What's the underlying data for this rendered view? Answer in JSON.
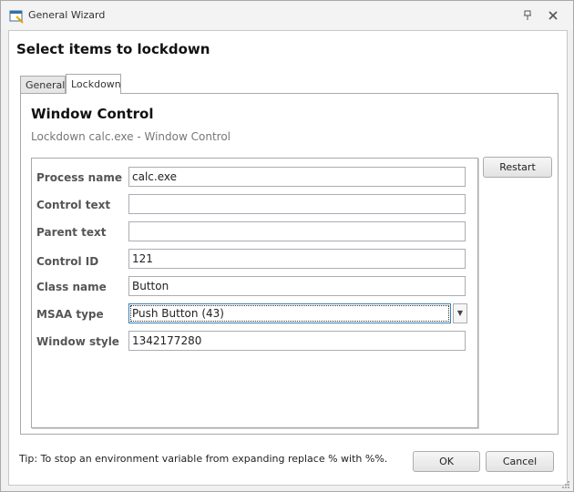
{
  "window": {
    "title": "General Wizard"
  },
  "page": {
    "title": "Select items to lockdown"
  },
  "tabs": [
    {
      "label": "General",
      "selected": false
    },
    {
      "label": "Lockdown",
      "selected": true
    }
  ],
  "section": {
    "title": "Window Control",
    "subtitle": "Lockdown calc.exe - Window Control"
  },
  "fields": {
    "process_name": {
      "label": "Process name",
      "value": "calc.exe"
    },
    "control_text": {
      "label": "Control text",
      "value": ""
    },
    "parent_text": {
      "label": "Parent text",
      "value": ""
    },
    "control_id": {
      "label": "Control ID",
      "value": "121"
    },
    "class_name": {
      "label": "Class name",
      "value": "Button"
    },
    "msaa_type": {
      "label": "MSAA type",
      "value": "Push Button (43)"
    },
    "window_style": {
      "label": "Window style",
      "value": "1342177280"
    }
  },
  "buttons": {
    "restart": "Restart",
    "ok": "OK",
    "cancel": "Cancel"
  },
  "tip": "Tip: To stop an environment variable from expanding replace % with %%.",
  "icons": {
    "app": "wizard-window-icon",
    "pin": "pin-icon",
    "close": "close-icon",
    "dropdown": "chevron-down-icon",
    "resize": "resize-grip-icon"
  }
}
